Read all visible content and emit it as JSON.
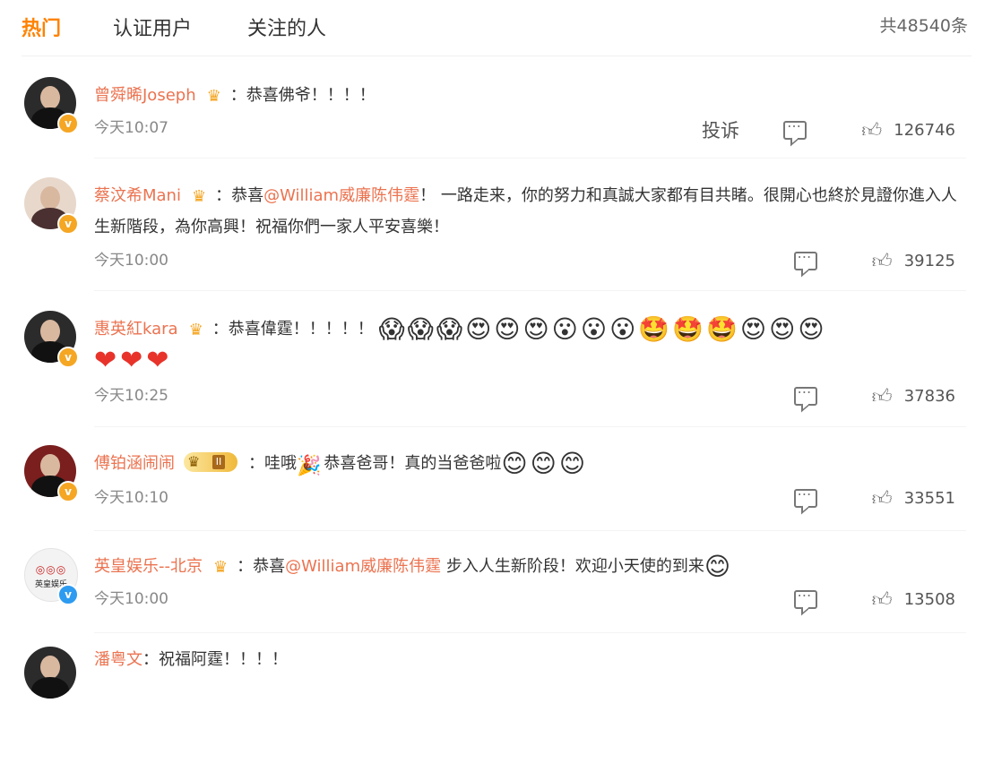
{
  "tabs": [
    {
      "label": "热门",
      "active": true
    },
    {
      "label": "认证用户",
      "active": false
    },
    {
      "label": "关注的人",
      "active": false
    }
  ],
  "total_label": "共48540条",
  "colors": {
    "accent": "#ff8200",
    "username": "#eb7350",
    "gold_badge": "#f5a623",
    "blue_badge": "#2d9bf0"
  },
  "comments": [
    {
      "user": "曾舜晞Joseph",
      "badge": "crown",
      "sep": "：",
      "text": "恭喜佛爷！！！！",
      "time": "今天10:07",
      "report": "投诉",
      "likes": "126746"
    },
    {
      "user": "蔡汶希Mani",
      "badge": "crown",
      "sep": "：",
      "text_before": "恭喜",
      "mention": "@William威廉陈伟霆",
      "text_after": "！ 一路走来，你的努力和真誠大家都有目共睹。很開心也終於見證你進入人生新階段，為你高興！祝福你們一家人平安喜樂！",
      "time": "今天10:00",
      "likes": "39125"
    },
    {
      "user": "惠英紅kara",
      "badge": "crown",
      "sep": "：",
      "text": "恭喜偉霆！！！！！",
      "emojis": [
        "😱",
        "😱",
        "😱",
        "😍",
        "😍",
        "😍",
        "😮",
        "😮",
        "😮",
        "🤩",
        "🤩",
        "🤩",
        "😍",
        "😍",
        "😍"
      ],
      "hearts": [
        "❤",
        "❤",
        "❤"
      ],
      "time": "今天10:25",
      "likes": "37836"
    },
    {
      "user": "傅铂涵闹闹",
      "badge": "vip",
      "vip_level": "II",
      "sep": "：",
      "text_before": "哇哦",
      "text_after": "恭喜爸哥！真的当爸爸啦",
      "emojis": [
        "😊",
        "😊",
        "😊"
      ],
      "time": "今天10:10",
      "likes": "33551"
    },
    {
      "user": "英皇娱乐--北京",
      "badge": "crown",
      "sep": "：",
      "text_before": "恭喜",
      "mention": "@William威廉陈伟霆",
      "text_after": " 步入人生新阶段！欢迎小天使的到来",
      "emojis": [
        "😊"
      ],
      "avatar_logo": "◎◎◎",
      "avatar_text": "英皇娱乐",
      "time": "今天10:00",
      "likes": "13508"
    },
    {
      "user": "潘粤文",
      "sep": "：",
      "text": "祝福阿霆！！！！"
    }
  ]
}
